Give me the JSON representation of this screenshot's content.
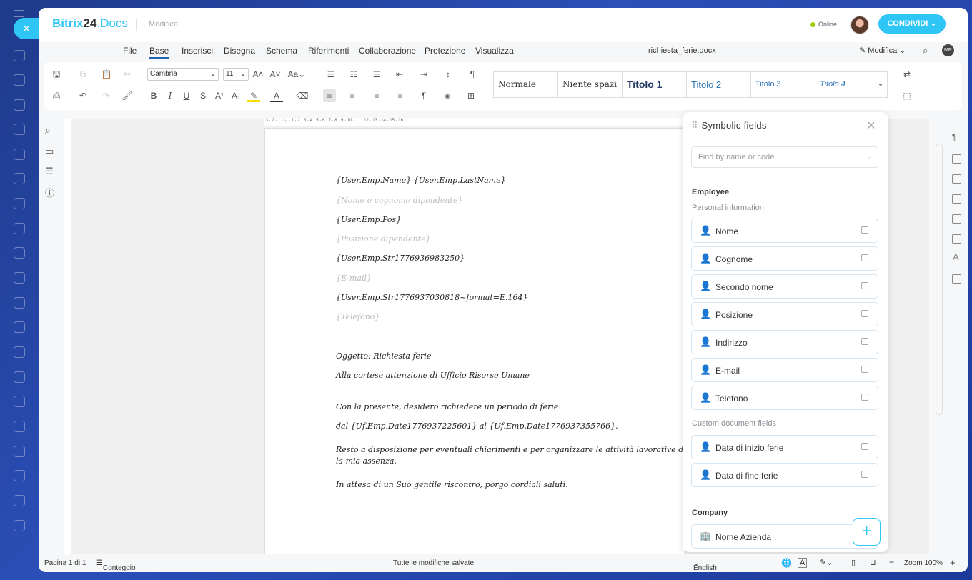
{
  "app": {
    "brand": "Bitrix",
    "brand_num": "24",
    "brand_suffix": ".Docs",
    "breadcrumb": "Modifica",
    "status": "Online",
    "share_label": "CONDIVIDI",
    "user_initials": "MR"
  },
  "menu": {
    "items": [
      "File",
      "Base",
      "Inserisci",
      "Disegna",
      "Schema",
      "Riferimenti",
      "Collaborazione",
      "Protezione",
      "Visualizza"
    ],
    "active": "Base",
    "doc_name": "richiesta_ferie.docx",
    "mode_label": "Modifica"
  },
  "ribbon": {
    "font": "Cambria",
    "size": "11",
    "styles": [
      "Normale",
      "Niente spazi",
      "Titolo 1",
      "Titolo 2",
      "Titolo 3",
      "Titolo 4"
    ]
  },
  "document": {
    "lines": [
      "{User.Emp.Name} {User.Emp.LastName}",
      "{Nome e cognome dipendente}",
      "{User.Emp.Pos}",
      "{Posizione dipendente}",
      "{User.Emp.Str1776936983250}",
      "{E-mail}",
      "{User.Emp.Str1776937030818~format=E.164}",
      "{Telefono}",
      "Oggetto: Richiesta ferie",
      "Alla cortese attenzione di Ufficio Risorse Umane",
      "Con la presente, desidero richiedere un periodo di ferie",
      "dal {Uf.Emp.Date1776937225601} al {Uf.Emp.Date1776937355766}.",
      "Resto a disposizione per eventuali chiarimenti e per organizzare le attività lavorative durante",
      "la mia assenza.",
      "In attesa di un Suo gentile riscontro, porgo cordiali saluti."
    ]
  },
  "panel": {
    "title": "Symbolic fields",
    "search_placeholder": "Find by name or code",
    "employee_title": "Employee",
    "personal_title": "Personal information",
    "personal_fields": [
      "Nome",
      "Cognome",
      "Secondo nome",
      "Posizione",
      "Indirizzo",
      "E-mail",
      "Telefono"
    ],
    "custom_title": "Custom document fields",
    "custom_fields": [
      "Data di inizio ferie",
      "Data di fine ferie"
    ],
    "company_title": "Company",
    "company_fields": [
      "Nome Azienda"
    ]
  },
  "status": {
    "page": "Pagina 1 di 1",
    "word_count": "Conteggio delle parole",
    "saved": "Tutte le modifiche salvate",
    "language": "English – United States",
    "zoom": "Zoom 100%"
  }
}
